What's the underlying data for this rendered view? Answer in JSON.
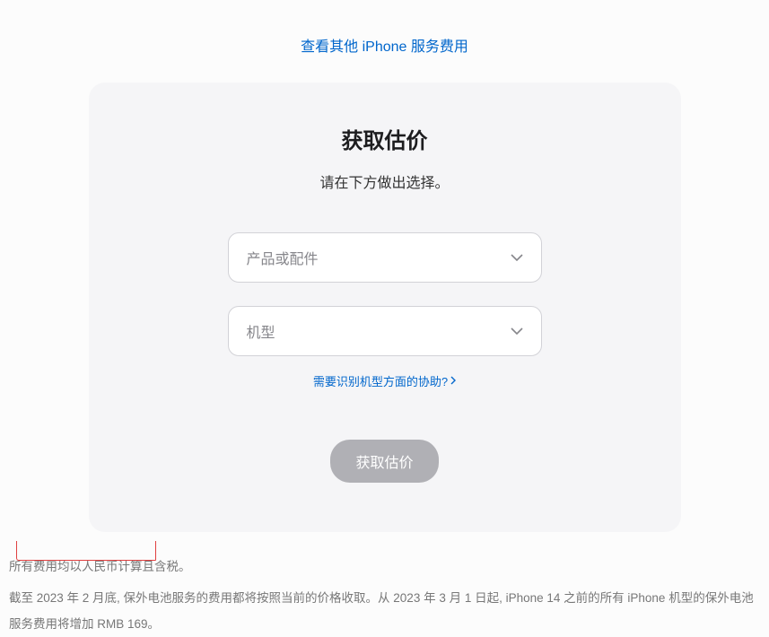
{
  "topLink": {
    "label": "查看其他 iPhone 服务费用"
  },
  "card": {
    "title": "获取估价",
    "subtitle": "请在下方做出选择。",
    "select1": {
      "placeholder": "产品或配件"
    },
    "select2": {
      "placeholder": "机型"
    },
    "helpLink": {
      "label": "需要识别机型方面的协助?"
    },
    "submitButton": {
      "label": "获取估价"
    }
  },
  "footer": {
    "line1": "所有费用均以人民币计算且含税。",
    "line2": "截至 2023 年 2 月底, 保外电池服务的费用都将按照当前的价格收取。从 2023 年 3 月 1 日起, iPhone 14 之前的所有 iPhone 机型的保外电池服务费用将增加 RMB 169。"
  }
}
